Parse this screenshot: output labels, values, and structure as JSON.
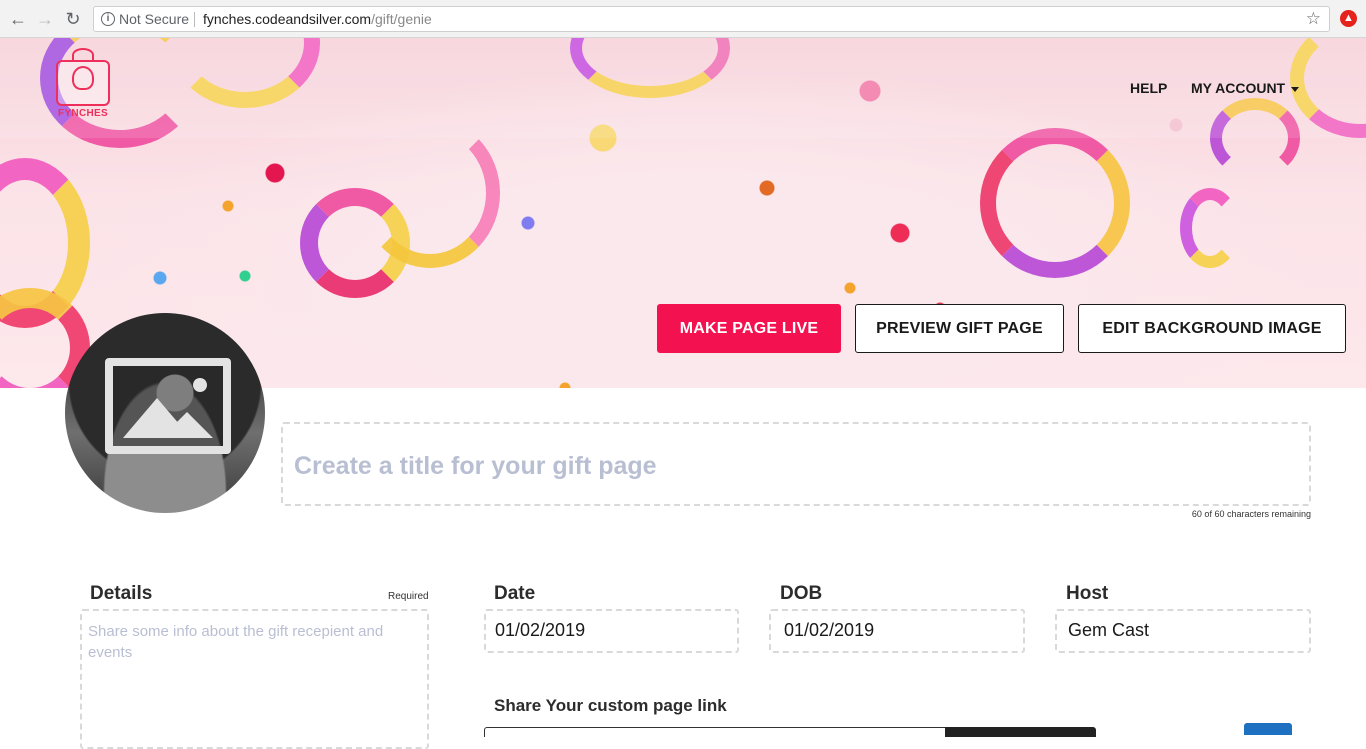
{
  "browser": {
    "security_text": "Not Secure",
    "url_host": "fynches.codeandsilver.com",
    "url_path": "/gift/genie"
  },
  "header": {
    "logo_text": "FYNCHES",
    "help": "HELP",
    "my_account": "MY ACCOUNT"
  },
  "actions": {
    "make_live": "MAKE PAGE LIVE",
    "preview": "PREVIEW GIFT PAGE",
    "edit_bg": "EDIT BACKGROUND IMAGE"
  },
  "title_field": {
    "placeholder": "Create a title for your gift page",
    "char_count": "60 of 60 characters remaining"
  },
  "form": {
    "details_label": "Details",
    "required": "Required",
    "details_placeholder": "Share some info about the gift recepient and events",
    "date_label": "Date",
    "date_value": "01/02/2019",
    "dob_label": "DOB",
    "dob_value": "01/02/2019",
    "host_label": "Host",
    "host_value": "Gem Cast",
    "share_label": "Share Your custom page link"
  },
  "colors": {
    "brand": "#f4114f",
    "placeholder": "#b9bfd2",
    "link_button": "#1e70c1"
  }
}
